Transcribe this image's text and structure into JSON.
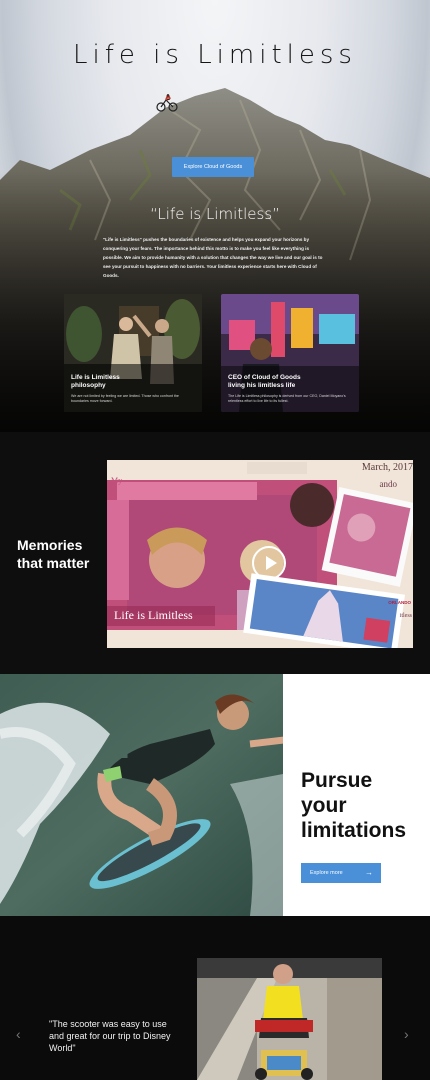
{
  "hero": {
    "title": "Life is Limitless",
    "cta_label": "Explore Cloud of Goods",
    "quote_title": "“Life is Limitless”",
    "quote_body": "\"Life is Limitless\" pushes the boundaries of existence and helps you expand your horizons by conquering your fears. The importance behind this motto is to make you feel like everything is possible. We aim to provide humanity with a solution that changes the way we live and our goal is to see your pursuit to happiness with no barriers. Your limitless experience starts here with Cloud of Goods."
  },
  "cards": [
    {
      "title": "Life is Limitless philosophy",
      "desc": "We are not limited by feeling we are limited. Those who confront the boundaries move forward."
    },
    {
      "title": "CEO of Cloud of Goods living his limitless life",
      "desc": "The Life is Limitless philosophy is derived from our CEO, Daniel Moyano's relentless effort to live life to its fullest."
    }
  ],
  "memories": {
    "title": "Memories that matter",
    "collage_caption": "Life is Limitless",
    "collage_date": "March, 2017",
    "collage_fragment_my": "My",
    "collage_fragment_ando": "ando",
    "collage_fragment_orlando": "ORLANDO",
    "collage_fragment_itless": "itless"
  },
  "pursue": {
    "title_line1": "Pursue",
    "title_line2": "your",
    "title_line3": "limitations",
    "cta_label": "Explore more",
    "cta_arrow": "→"
  },
  "testimonial": {
    "quote": "\"The scooter was easy to use and great for our trip to Disney World\"",
    "prev": "‹",
    "next": "›"
  },
  "colors": {
    "accent": "#4a90d9",
    "dark_bg": "#0e0e0e"
  }
}
